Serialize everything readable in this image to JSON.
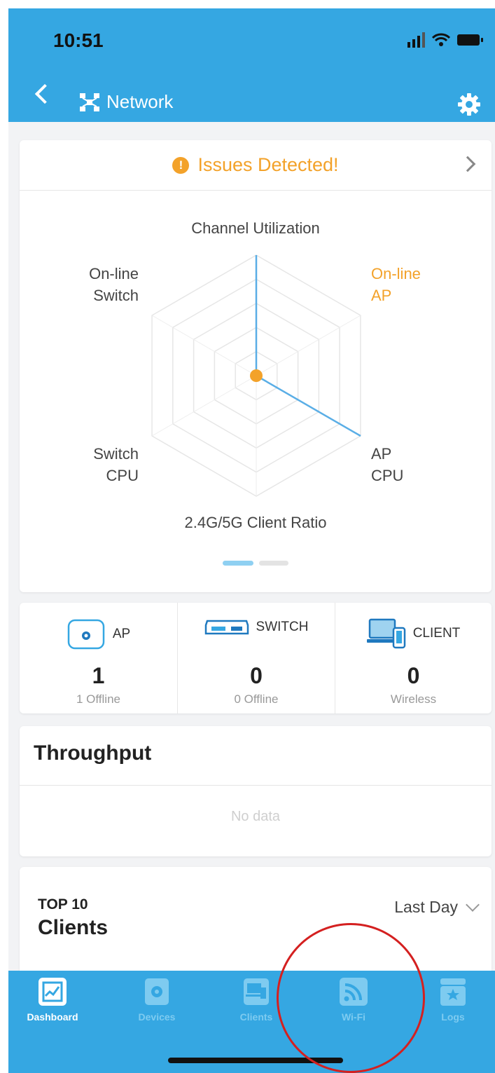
{
  "status_bar": {
    "time": "10:51"
  },
  "nav": {
    "title": "Network"
  },
  "issues": {
    "text": "Issues Detected!"
  },
  "radar": {
    "labels": {
      "channel_utilization": "Channel Utilization",
      "online_switch": [
        "On-line",
        "Switch"
      ],
      "online_ap": [
        "On-line",
        "AP"
      ],
      "switch_cpu": [
        "Switch",
        "CPU"
      ],
      "ap_cpu": [
        "AP",
        "CPU"
      ],
      "client_ratio": "2.4G/5G Client Ratio"
    }
  },
  "chart_data": {
    "type": "radar",
    "axes": [
      "Channel Utilization",
      "On-line AP",
      "AP CPU",
      "2.4G/5G Client Ratio",
      "Switch CPU",
      "On-line Switch"
    ],
    "values": [
      1,
      0,
      1,
      0,
      0,
      0
    ],
    "range": [
      0,
      1
    ],
    "rings": 5,
    "highlight_axis": "On-line AP"
  },
  "pager": {
    "pages": 2,
    "active_index": 0
  },
  "stats": [
    {
      "title": "AP",
      "count": "1",
      "sub": "1 Offline"
    },
    {
      "title": "SWITCH",
      "count": "0",
      "sub": "0 Offline"
    },
    {
      "title": "CLIENT",
      "count": "0",
      "sub": "Wireless"
    }
  ],
  "throughput": {
    "title": "Throughput",
    "empty_text": "No data"
  },
  "top_clients": {
    "label": "TOP 10",
    "title": "Clients",
    "period": "Last Day"
  },
  "tabs": [
    {
      "label": "Dashboard",
      "icon": "chart-icon",
      "active": true
    },
    {
      "label": "Devices",
      "icon": "device-icon",
      "active": false
    },
    {
      "label": "Clients",
      "icon": "clients-icon",
      "active": false
    },
    {
      "label": "Wi-Fi",
      "icon": "wifi-icon",
      "active": false
    },
    {
      "label": "Logs",
      "icon": "logs-icon",
      "active": false
    }
  ],
  "colors": {
    "brand": "#35a7e2",
    "warning": "#f3a22a",
    "annotation": "#d42020"
  }
}
